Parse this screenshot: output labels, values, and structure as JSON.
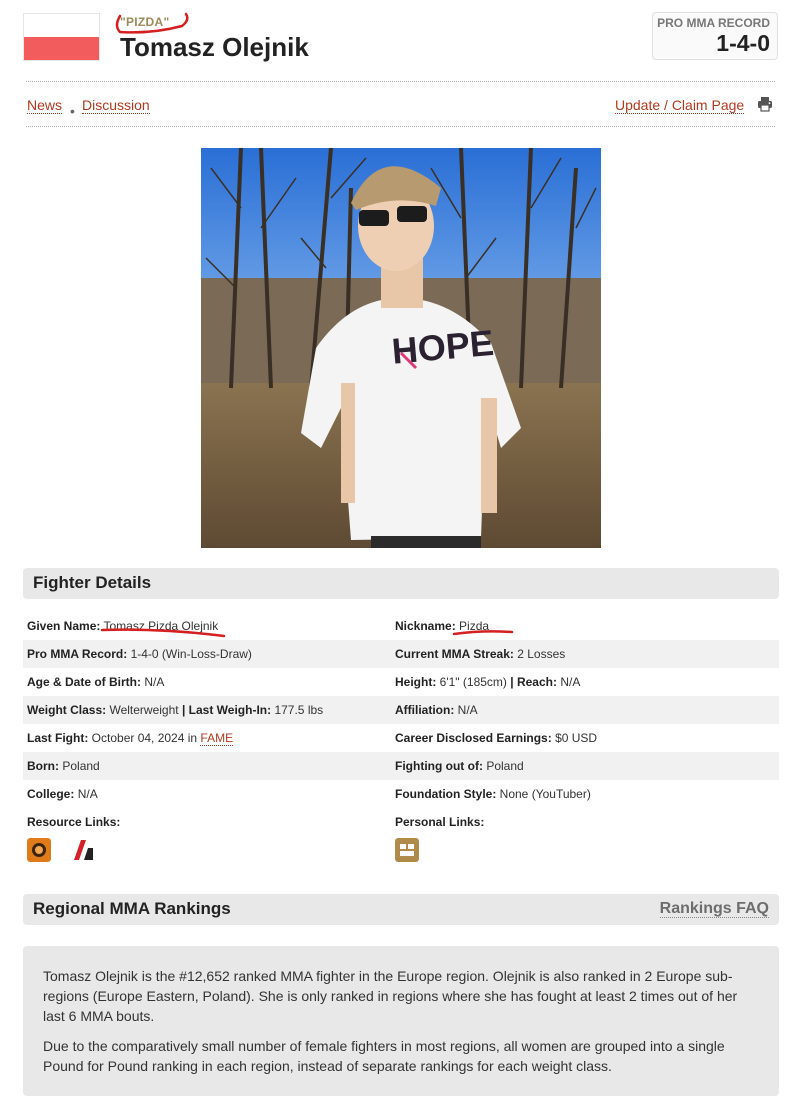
{
  "header": {
    "nickname_tag": "\"PIZDA\"",
    "name": "Tomasz Olejnik",
    "record_label": "PRO MMA RECORD",
    "record_value": "1-4-0"
  },
  "nav": {
    "news": "News",
    "discussion": "Discussion",
    "update": "Update / Claim Page"
  },
  "details": {
    "title": "Fighter Details",
    "left": [
      {
        "label": "Given Name:",
        "value": "Tomasz Pizda Olejnik"
      },
      {
        "label": "Pro MMA Record:",
        "value": "1-4-0 (Win-Loss-Draw)"
      },
      {
        "label": "Age & Date of Birth:",
        "value": "N/A"
      },
      {
        "label": "Weight Class:",
        "value": "Welterweight",
        "label2": "Last Weigh-In:",
        "value2": "177.5 lbs"
      },
      {
        "label": "Last Fight:",
        "value": "October 04, 2024 in",
        "link": "FAME"
      },
      {
        "label": "Born:",
        "value": "Poland"
      },
      {
        "label": "College:",
        "value": "N/A"
      },
      {
        "label": "Resource Links:",
        "value": ""
      }
    ],
    "right": [
      {
        "label": "Nickname:",
        "value": "Pizda"
      },
      {
        "label": "Current MMA Streak:",
        "value": "2 Losses"
      },
      {
        "label": "Height:",
        "value": "6'1\" (185cm)",
        "label2": "Reach:",
        "value2": "N/A"
      },
      {
        "label": "Affiliation:",
        "value": "N/A"
      },
      {
        "label": "Career Disclosed Earnings:",
        "value": "$0 USD"
      },
      {
        "label": "Fighting out of:",
        "value": "Poland"
      },
      {
        "label": "Foundation Style:",
        "value": "None (YouTuber)"
      },
      {
        "label": "Personal Links:",
        "value": ""
      }
    ],
    "separator": "|"
  },
  "rankings": {
    "title": "Regional MMA Rankings",
    "faq": "Rankings FAQ",
    "p1": "Tomasz Olejnik is the #12,652 ranked MMA fighter in the Europe region. Olejnik is also ranked in 2 Europe sub-regions (Europe Eastern, Poland). She is only ranked in regions where she has fought at least 2 times out of her last 6 MMA bouts.",
    "p2": "Due to the comparatively small number of female fighters in most regions, all women are grouped into a single Pound for Pound ranking in each region, instead of separate rankings for each weight class."
  },
  "colors": {
    "link": "#b03a1f",
    "flag_red": "#f25c5c",
    "annotation_red": "#d42020",
    "section_bg": "#e8e8e8"
  },
  "icons": {
    "resource_1": "tapology-icon",
    "resource_2": "sherdog-icon",
    "personal_1": "website-icon",
    "print": "print-icon"
  }
}
